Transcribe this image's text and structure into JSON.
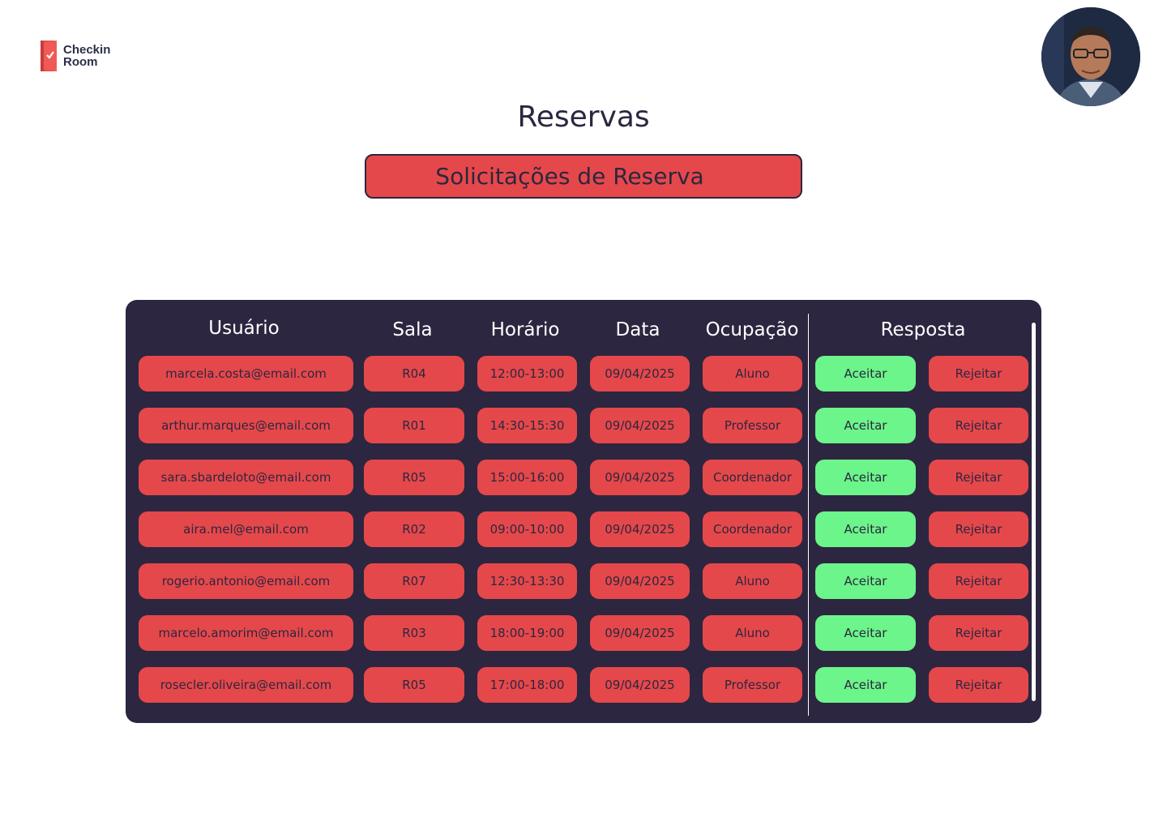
{
  "brand": {
    "line1": "Checkin",
    "line2": "Room"
  },
  "page": {
    "title": "Reservas",
    "section_button": "Solicitações de Reserva"
  },
  "table": {
    "headers": {
      "user": "Usuário",
      "room": "Sala",
      "time": "Horário",
      "date": "Data",
      "occupation": "Ocupação",
      "response": "Resposta"
    },
    "rows": [
      {
        "user": "marcela.costa@email.com",
        "room": "R04",
        "time": "12:00-13:00",
        "date": "09/04/2025",
        "occupation": "Aluno",
        "accept": "Aceitar",
        "reject": "Rejeitar"
      },
      {
        "user": "arthur.marques@email.com",
        "room": "R01",
        "time": "14:30-15:30",
        "date": "09/04/2025",
        "occupation": "Professor",
        "accept": "Aceitar",
        "reject": "Rejeitar"
      },
      {
        "user": "sara.sbardeloto@email.com",
        "room": "R05",
        "time": "15:00-16:00",
        "date": "09/04/2025",
        "occupation": "Coordenador",
        "accept": "Aceitar",
        "reject": "Rejeitar"
      },
      {
        "user": "aira.mel@email.com",
        "room": "R02",
        "time": "09:00-10:00",
        "date": "09/04/2025",
        "occupation": "Coordenador",
        "accept": "Aceitar",
        "reject": "Rejeitar"
      },
      {
        "user": "rogerio.antonio@email.com",
        "room": "R07",
        "time": "12:30-13:30",
        "date": "09/04/2025",
        "occupation": "Aluno",
        "accept": "Aceitar",
        "reject": "Rejeitar"
      },
      {
        "user": "marcelo.amorim@email.com",
        "room": "R03",
        "time": "18:00-19:00",
        "date": "09/04/2025",
        "occupation": "Aluno",
        "accept": "Aceitar",
        "reject": "Rejeitar"
      },
      {
        "user": "rosecler.oliveira@email.com",
        "room": "R05",
        "time": "17:00-18:00",
        "date": "09/04/2025",
        "occupation": "Professor",
        "accept": "Aceitar",
        "reject": "Rejeitar"
      }
    ]
  },
  "colors": {
    "panel": "#2d2640",
    "reject": "#e5484a",
    "accept": "#6cf58a",
    "text": "#2d2640"
  },
  "icons": {
    "logo": "door-check-icon",
    "avatar": "user-avatar"
  }
}
